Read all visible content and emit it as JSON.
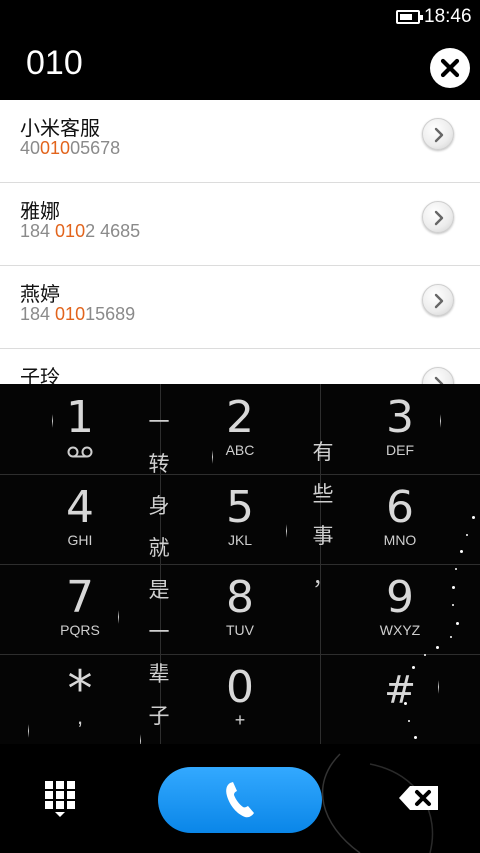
{
  "status_bar": {
    "time": "18:46",
    "battery_icon": "battery-icon"
  },
  "header": {
    "typed_number": "010",
    "clear_icon": "close-icon"
  },
  "contacts": [
    {
      "name": "小米客服",
      "number_pre": "40",
      "number_match": "010",
      "number_post": "05678"
    },
    {
      "name": "雅娜",
      "number_pre": "184 ",
      "number_match": "010",
      "number_post": "2 4685"
    },
    {
      "name": "燕婷",
      "number_pre": "184 ",
      "number_match": "010",
      "number_post": "15689"
    },
    {
      "name": "子玲",
      "number_pre": "",
      "number_match": "",
      "number_post": ""
    }
  ],
  "dialpad": {
    "keys": [
      {
        "digit": "1",
        "letters": ""
      },
      {
        "digit": "2",
        "letters": "ABC"
      },
      {
        "digit": "3",
        "letters": "DEF"
      },
      {
        "digit": "4",
        "letters": "GHI"
      },
      {
        "digit": "5",
        "letters": "JKL"
      },
      {
        "digit": "6",
        "letters": "MNO"
      },
      {
        "digit": "7",
        "letters": "PQRS"
      },
      {
        "digit": "8",
        "letters": "TUV"
      },
      {
        "digit": "9",
        "letters": "WXYZ"
      },
      {
        "digit": "*",
        "letters": ","
      },
      {
        "digit": "0",
        "letters": "+"
      },
      {
        "digit": "#",
        "letters": ""
      }
    ],
    "poem_left": [
      "一",
      "转",
      "身",
      "就",
      "是",
      "一",
      "辈",
      "子"
    ],
    "poem_right": [
      "有",
      "些",
      "事",
      "，"
    ]
  },
  "bottom_bar": {
    "keypad_icon": "keypad-grid-icon",
    "call_icon": "phone-icon",
    "delete_icon": "backspace-icon"
  },
  "colors": {
    "highlight": "#e2641c",
    "call_button": "#1a96f2"
  }
}
